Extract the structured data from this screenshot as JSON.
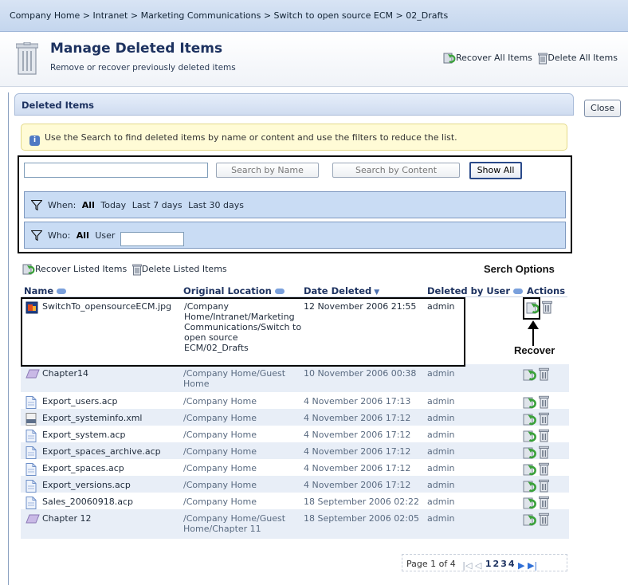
{
  "breadcrumb": "Company Home > Intranet > Marketing Communications > Switch to open source ECM > 02_Drafts",
  "header": {
    "title": "Manage Deleted Items",
    "subtitle": "Remove or recover previously deleted items",
    "recover_all": "Recover All Items",
    "delete_all": "Delete All Items"
  },
  "panel": {
    "title": "Deleted Items",
    "close_label": "Close",
    "info": "Use the Search to find deleted items by name or content and use the filters to reduce the list."
  },
  "search": {
    "value": "",
    "by_name": "Search by Name",
    "by_content": "Search by Content",
    "show_all": "Show All"
  },
  "filters": {
    "when_label": "When:",
    "when_options": [
      "All",
      "Today",
      "Last 7 days",
      "Last 30 days"
    ],
    "who_label": "Who:",
    "who_options": [
      "All",
      "User"
    ],
    "who_value": ""
  },
  "list_actions": {
    "recover_listed": "Recover Listed Items",
    "delete_listed": "Delete Listed Items"
  },
  "annotations": {
    "search_options": "Serch Options",
    "recover": "Recover"
  },
  "columns": {
    "name": "Name",
    "location": "Original Location",
    "date": "Date Deleted",
    "user": "Deleted by User",
    "actions": "Actions"
  },
  "rows": [
    {
      "name": "SwitchTo_opensourceECM.jpg",
      "icon": "image-file-icon",
      "location": "/Company Home/Intranet/Marketing Communications/Switch to open source ECM/02_Drafts",
      "date": "12 November 2006 21:55",
      "user": "admin"
    },
    {
      "name": "Chapter14",
      "icon": "space-icon",
      "location": "/Company Home/Guest Home",
      "date": "10 November 2006 00:38",
      "user": "admin"
    },
    {
      "name": "Export_users.acp",
      "icon": "document-icon",
      "location": "/Company Home",
      "date": "4 November 2006 17:13",
      "user": "admin"
    },
    {
      "name": "Export_systeminfo.xml",
      "icon": "xml-file-icon",
      "location": "/Company Home",
      "date": "4 November 2006 17:12",
      "user": "admin"
    },
    {
      "name": "Export_system.acp",
      "icon": "document-icon",
      "location": "/Company Home",
      "date": "4 November 2006 17:12",
      "user": "admin"
    },
    {
      "name": "Export_spaces_archive.acp",
      "icon": "document-icon",
      "location": "/Company Home",
      "date": "4 November 2006 17:12",
      "user": "admin"
    },
    {
      "name": "Export_spaces.acp",
      "icon": "document-icon",
      "location": "/Company Home",
      "date": "4 November 2006 17:12",
      "user": "admin"
    },
    {
      "name": "Export_versions.acp",
      "icon": "document-icon",
      "location": "/Company Home",
      "date": "4 November 2006 17:12",
      "user": "admin"
    },
    {
      "name": "Sales_20060918.acp",
      "icon": "document-icon",
      "location": "/Company Home",
      "date": "18 September 2006 02:22",
      "user": "admin"
    },
    {
      "name": "Chapter 12",
      "icon": "space-icon",
      "location": "/Company Home/Guest Home/Chapter 11",
      "date": "18 September 2006 02:05",
      "user": "admin"
    }
  ],
  "pagination": {
    "label": "Page 1 of 4",
    "pages": [
      "1",
      "2",
      "3",
      "4"
    ]
  },
  "colors": {
    "breadcrumb_bg": "#c8d9f0",
    "filter_bg": "#c9dcf4",
    "alt_row_bg": "#e8eef7",
    "info_bg": "#fffbd6",
    "title": "#1d3260"
  }
}
